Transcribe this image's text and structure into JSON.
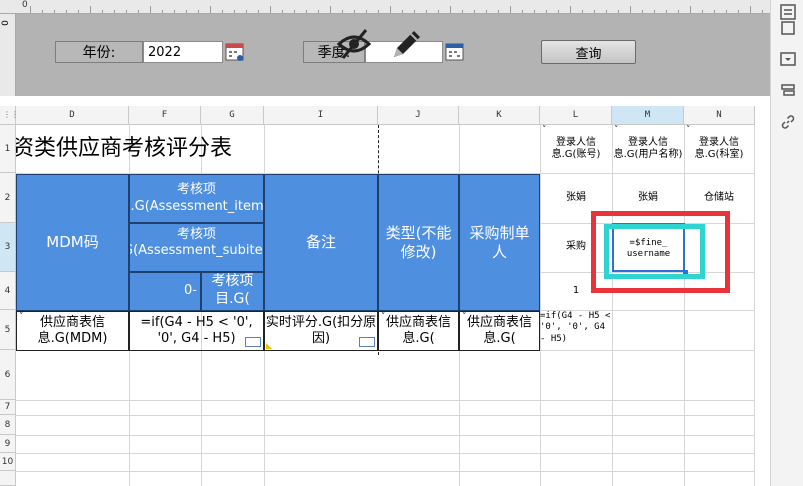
{
  "ruler": {
    "zero_h": "0",
    "zero_v": "0"
  },
  "params": {
    "year_label": "年份:",
    "year_value": "2022",
    "season_label": "季度:",
    "query_label": "查询"
  },
  "icons": {
    "calendar_year": "calendar-icon",
    "hide_eye": "eye-slash-icon",
    "pencil": "pencil-icon",
    "calendar_season": "calendar-icon"
  },
  "columns": [
    "D",
    "F",
    "G",
    "I",
    "J",
    "K",
    "L",
    "M",
    "N"
  ],
  "rows": [
    "1",
    "2",
    "3",
    "4",
    "5",
    "6",
    "7",
    "8",
    "9",
    "10"
  ],
  "cells": {
    "title": "资类供应商考核评分表",
    "l1": "登录人信息.G(账号)",
    "m1": "登录人信息.G(用户名称)",
    "n1": "登录人信息.G(科室)",
    "l2": "张娟",
    "m2": "张娟",
    "n2": "仓储站",
    "l3": "采购",
    "m3_formula_1": "=$fine_",
    "m3_formula_2": "username",
    "l4": "1",
    "mdm": "MDM码",
    "item1": "考核项目.G(Assessment_items)",
    "item2": "考核项目.G(Assessment_subitems)",
    "f4_prefix": "0-",
    "g4": "考核项目.G(",
    "remark": "备注",
    "type": "类型(不能修改)",
    "buyer": "采购制单人",
    "d5": "供应商表信息.G(MDM)",
    "fg5": "=if(G4 - H5 < '0', '0', G4 - H5)",
    "i5": "实时评分.G(扣分原因)",
    "j5": "供应商表信息.G(",
    "k5": "供应商表信息.G(",
    "l5": "=if(G4 - H5 < '0', '0', G4 - H5)"
  },
  "colors": {
    "header_blue": "#4f8fe0",
    "highlight_red": "#e8333a",
    "highlight_cyan": "#2fd3cf",
    "selection_blue": "#2f6fd8"
  }
}
